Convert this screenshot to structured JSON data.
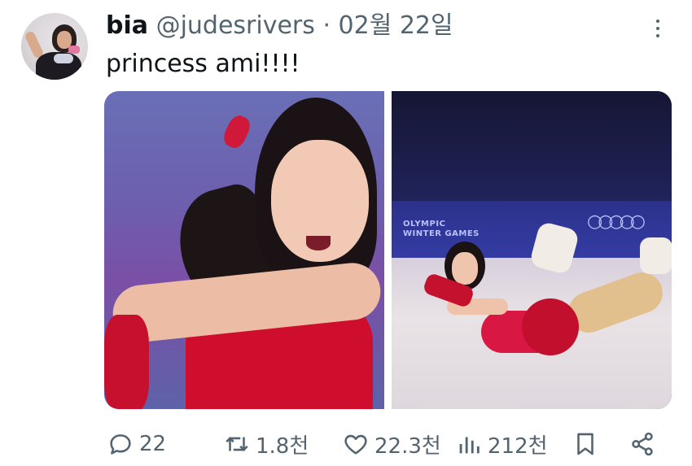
{
  "tweet": {
    "display_name": "bia",
    "handle": "@judesrivers",
    "separator": "·",
    "date": "02월 22일",
    "text": "princess ami!!!!"
  },
  "media": {
    "right_board_text": "OLYMPIC\nWINTER GAMES",
    "right_rings": "○○○○○"
  },
  "actions": {
    "reply_count": "22",
    "retweet_count": "1.8천",
    "like_count": "22.3천",
    "view_count": "212천"
  },
  "icons": {
    "more": "more-dots-icon",
    "reply": "reply-bubble-icon",
    "retweet": "retweet-icon",
    "like": "heart-icon",
    "views": "bar-chart-icon",
    "bookmark": "bookmark-icon",
    "share": "share-icon"
  }
}
